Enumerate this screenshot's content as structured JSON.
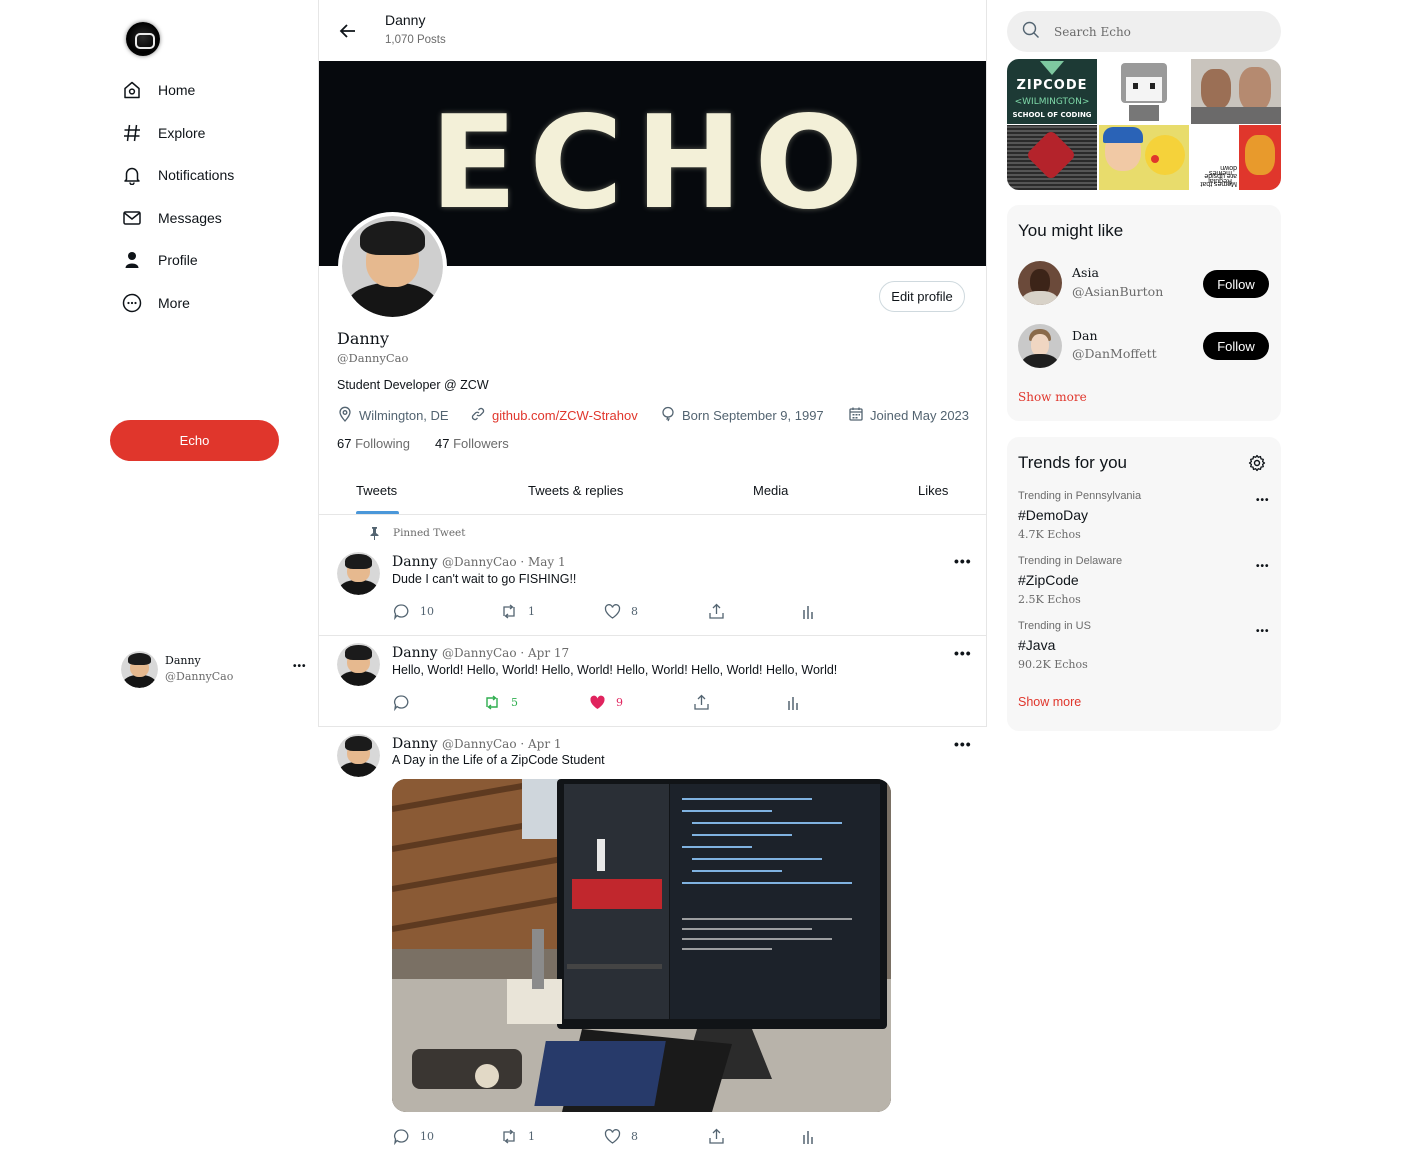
{
  "sidebar": {
    "items": [
      {
        "label": "Home",
        "icon": "home-icon"
      },
      {
        "label": "Explore",
        "icon": "hashtag-icon"
      },
      {
        "label": "Notifications",
        "icon": "bell-icon"
      },
      {
        "label": "Messages",
        "icon": "mail-icon"
      },
      {
        "label": "Profile",
        "icon": "person-icon"
      },
      {
        "label": "More",
        "icon": "more-circle-icon"
      }
    ],
    "echo_button": "Echo",
    "account": {
      "name": "Danny",
      "handle": "@DannyCao",
      "more": "•••"
    }
  },
  "header": {
    "name": "Danny",
    "post_count": "1,070 Posts"
  },
  "banner": {
    "text": "ECHO"
  },
  "profile": {
    "edit_label": "Edit profile",
    "name": "Danny",
    "handle": "@DannyCao",
    "bio": "Student Developer @ ZCW",
    "location": "Wilmington, DE",
    "link": "github.com/ZCW-Strahov",
    "born": "Born September 9, 1997",
    "joined": "Joined May 2023",
    "following_count": "67",
    "following_label": "Following",
    "followers_count": "47",
    "followers_label": "Followers"
  },
  "tabs": [
    "Tweets",
    "Tweets & replies",
    "Media",
    "Likes"
  ],
  "pinned_label": "Pinned Tweet",
  "tweets": [
    {
      "name": "Danny",
      "meta": "@DannyCao · May 1",
      "text": "Dude I can't wait to go FISHING!!",
      "replies": "10",
      "retweets": "1",
      "likes": "8"
    },
    {
      "name": "Danny",
      "meta": "@DannyCao · Apr 17",
      "text": "Hello, World! Hello, World! Hello, World! Hello, World! Hello, World! Hello, World!",
      "replies": "",
      "retweets": "5",
      "likes": "9"
    },
    {
      "name": "Danny",
      "meta": "@DannyCao · Apr 1",
      "text": "A Day in the Life of a ZipCode Student",
      "replies": "10",
      "retweets": "1",
      "likes": "8"
    }
  ],
  "search": {
    "placeholder": "Search Echo"
  },
  "media_grid": {
    "zipcode_line1": "ZIPCODE",
    "zipcode_line2": "<WILMINGTON>",
    "zipcode_line3": "SCHOOL OF CODING",
    "meme_text_a": "Memes that are upside down",
    "meme_text_b": "Regular memes"
  },
  "suggestions": {
    "title": "You might like",
    "users": [
      {
        "name": "Asia",
        "handle": "@AsianBurton",
        "button": "Follow"
      },
      {
        "name": "Dan",
        "handle": "@DanMoffett",
        "button": "Follow"
      }
    ],
    "show_more": "Show more"
  },
  "trends": {
    "title": "Trends for you",
    "items": [
      {
        "category": "Trending in Pennsylvania",
        "tag": "#DemoDay",
        "count": "4.7K Echos"
      },
      {
        "category": "Trending in Delaware",
        "tag": "#ZipCode",
        "count": "2.5K Echos"
      },
      {
        "category": "Trending in US",
        "tag": "#Java",
        "count": "90.2K Echos"
      }
    ],
    "show_more": "Show more"
  },
  "colors": {
    "accent": "#e0362c",
    "tab_underline": "#4a97d9",
    "retweet_active": "#2fae4f",
    "like_active": "#e0245e"
  }
}
